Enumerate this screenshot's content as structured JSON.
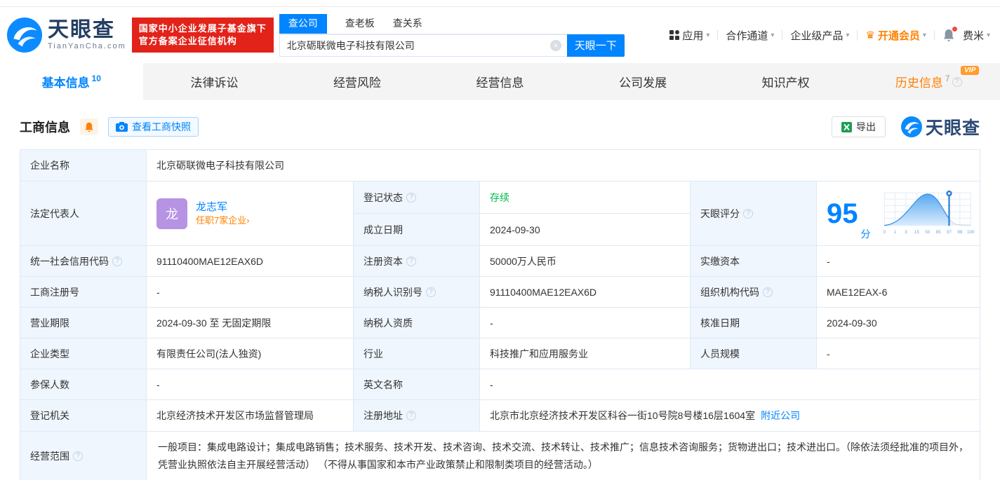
{
  "icons": {
    "caret": "▾",
    "help": "?",
    "clear": "×",
    "crown": "♛"
  },
  "header": {
    "brand": {
      "name": "天眼查",
      "domain": "TianYanCha.com"
    },
    "badge": {
      "line1": "国家中小企业发展子基金旗下",
      "line2": "官方备案企业征信机构"
    },
    "search": {
      "tabs": [
        {
          "label": "查公司"
        },
        {
          "label": "查老板"
        },
        {
          "label": "查关系"
        }
      ],
      "value": "北京砺联微电子科技有限公司",
      "submit": "天眼一下"
    },
    "nav": {
      "apps": "应用",
      "partner": "合作通道",
      "enterprise": "企业级产品",
      "vip": "开通会员",
      "user": "费米"
    }
  },
  "tabbar": {
    "items": [
      {
        "label": "基本信息",
        "count": "10"
      },
      {
        "label": "法律诉讼",
        "count": ""
      },
      {
        "label": "经营风险",
        "count": ""
      },
      {
        "label": "经营信息",
        "count": ""
      },
      {
        "label": "公司发展",
        "count": ""
      },
      {
        "label": "知识产权",
        "count": ""
      },
      {
        "label": "历史信息",
        "count": "7",
        "vip": "VIP"
      }
    ]
  },
  "section": {
    "title": "工商信息",
    "snapshot": "查看工商快照",
    "export": "导出",
    "watermark": "天眼查"
  },
  "info": {
    "company_name": {
      "label": "企业名称",
      "value": "北京砺联微电子科技有限公司"
    },
    "legal_rep": {
      "label": "法定代表人",
      "avatar": "龙",
      "name": "龙志军",
      "positions": "任职7家企业›"
    },
    "reg_status": {
      "label": "登记状态",
      "value": "存续"
    },
    "establish_date": {
      "label": "成立日期",
      "value": "2024-09-30"
    },
    "score": {
      "label": "天眼评分",
      "value": "95",
      "unit": "分",
      "ticks": [
        "0",
        "1",
        "3",
        "15",
        "50",
        "85",
        "97",
        "99",
        "100"
      ]
    },
    "credit_code": {
      "label": "统一社会信用代码",
      "value": "91110400MAE12EAX6D"
    },
    "reg_capital": {
      "label": "注册资本",
      "value": "50000万人民币"
    },
    "paid_capital": {
      "label": "实缴资本",
      "value": "-"
    },
    "reg_number": {
      "label": "工商注册号",
      "value": "-"
    },
    "taxpayer_id": {
      "label": "纳税人识别号",
      "value": "91110400MAE12EAX6D"
    },
    "org_code": {
      "label": "组织机构代码",
      "value": "MAE12EAX-6"
    },
    "business_term": {
      "label": "营业期限",
      "value": "2024-09-30 至 无固定期限"
    },
    "taxpayer_quality": {
      "label": "纳税人资质",
      "value": "-"
    },
    "approval_date": {
      "label": "核准日期",
      "value": "2024-09-30"
    },
    "company_type": {
      "label": "企业类型",
      "value": "有限责任公司(法人独资)"
    },
    "industry": {
      "label": "行业",
      "value": "科技推广和应用服务业"
    },
    "staff_size": {
      "label": "人员规模",
      "value": "-"
    },
    "insured_count": {
      "label": "参保人数",
      "value": "-"
    },
    "english_name": {
      "label": "英文名称",
      "value": "-"
    },
    "reg_authority": {
      "label": "登记机关",
      "value": "北京经济技术开发区市场监督管理局"
    },
    "reg_address": {
      "label": "注册地址",
      "value": "北京市北京经济技术开发区科谷一街10号院8号楼16层1604室",
      "nearby": "附近公司"
    },
    "business_scope": {
      "label": "经营范围",
      "value": "一般项目：集成电路设计；集成电路销售；技术服务、技术开发、技术咨询、技术交流、技术转让、技术推广；信息技术咨询服务；货物进出口；技术进出口。（除依法须经批准的项目外，凭营业执照依法自主开展经营活动） （不得从事国家和本市产业政策禁止和限制类项目的经营活动。）"
    }
  }
}
